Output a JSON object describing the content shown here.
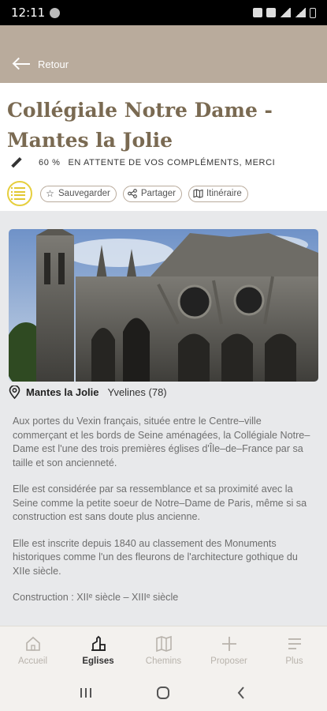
{
  "status_bar": {
    "time": "12:11"
  },
  "header": {
    "back_label": "Retour"
  },
  "page": {
    "title": "Collégiale Notre Dame - Mantes la Jolie",
    "completion_percent": "60 %",
    "completion_status": "EN ATTENTE DE VOS COMPLÉMENTS, MERCI"
  },
  "actions": {
    "save_label": "Sauvegarder",
    "share_label": "Partager",
    "route_label": "Itinéraire"
  },
  "location": {
    "town": "Mantes la Jolie",
    "department": "Yvelines (78)"
  },
  "description": {
    "p1": "Aux portes du Vexin français, située entre le Centre–ville commerçant et les bords de Seine aménagées, la Collégiale Notre–Dame est l'une des trois premières églises d'Île–de–France par sa taille et son ancienneté.",
    "p2": "Elle est considérée par sa ressemblance et sa proximité avec la Seine comme la petite soeur de Notre–Dame de Paris, même si sa construction est sans doute plus ancienne.",
    "p3": "Elle est inscrite depuis 1840 au classement des Monuments historiques comme l'un des fleurons de l'architecture gothique du XIIe siècle.",
    "p4": "Construction : XIIᵉ siècle – XIIIᵉ siècle"
  },
  "bottom_nav": {
    "items": [
      {
        "label": "Accueil",
        "icon": "home-icon",
        "active": false
      },
      {
        "label": "Eglises",
        "icon": "church-icon",
        "active": true
      },
      {
        "label": "Chemins",
        "icon": "map-icon",
        "active": false
      },
      {
        "label": "Proposer",
        "icon": "plus-icon",
        "active": false
      },
      {
        "label": "Plus",
        "icon": "menu-icon",
        "active": false
      }
    ]
  },
  "colors": {
    "header_bg": "#b9ab9c",
    "title_color": "#7a6a52",
    "accent_yellow": "#e6cf3e",
    "content_bg": "#e8e9eb"
  }
}
